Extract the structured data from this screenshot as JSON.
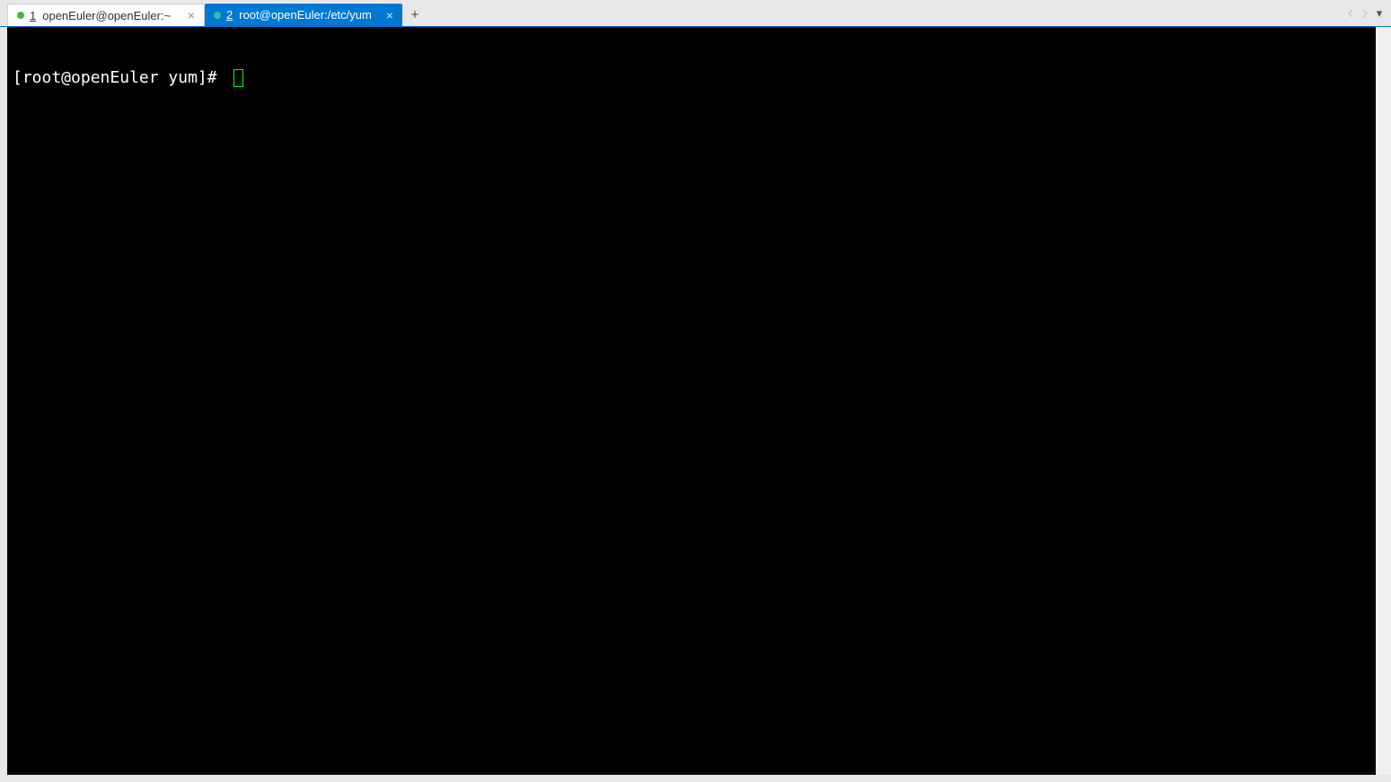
{
  "tabs": [
    {
      "index": "1",
      "title": "openEuler@openEuler:~",
      "status_color": "green",
      "active": false,
      "close_glyph": "×"
    },
    {
      "index": "2",
      "title": "root@openEuler:/etc/yum",
      "status_color": "teal",
      "active": true,
      "close_glyph": "×"
    }
  ],
  "new_tab_glyph": "+",
  "nav": {
    "prev_glyph": "◀",
    "next_glyph": "▶",
    "dropdown_glyph": "▾"
  },
  "terminal": {
    "prompt": "[root@openEuler yum]# "
  }
}
